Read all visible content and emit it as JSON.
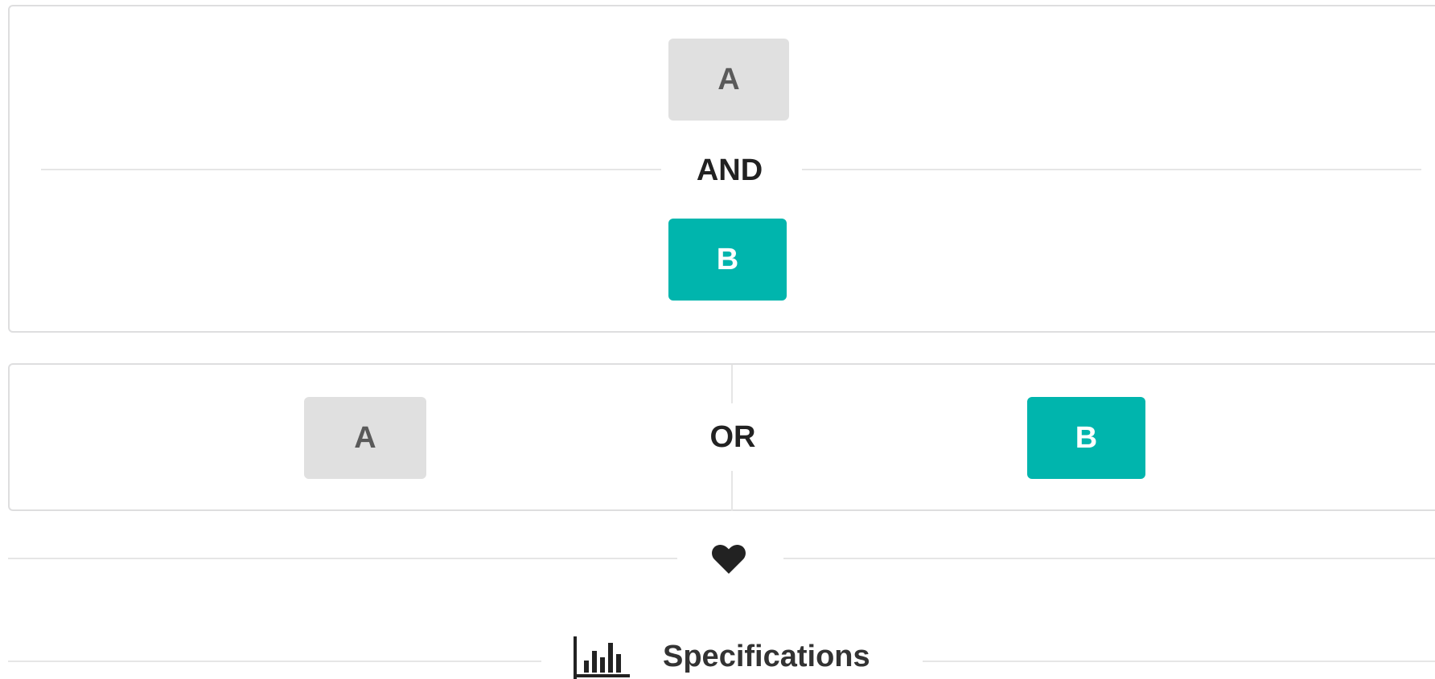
{
  "and_segment": {
    "button_a_label": "A",
    "divider_label": "AND",
    "button_b_label": "B"
  },
  "or_segment": {
    "button_a_label": "A",
    "divider_label": "OR",
    "button_b_label": "B"
  },
  "heart_divider": {
    "icon": "heart-icon"
  },
  "spec_divider": {
    "icon": "bar-chart-icon",
    "label": "Specifications"
  },
  "colors": {
    "teal": "#00b5ad",
    "grey_button": "#e0e0e0",
    "divider_line": "#e6e6e6",
    "segment_border": "#dededf",
    "text": "#222222"
  }
}
